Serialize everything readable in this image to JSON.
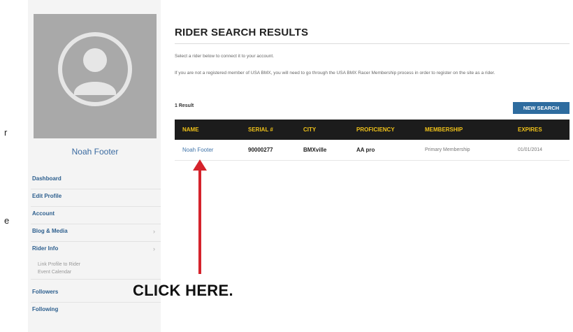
{
  "edge_fragments": [
    "r",
    "e"
  ],
  "sidebar": {
    "profile_name": "Noah Footer",
    "nav": [
      {
        "label": "Dashboard"
      },
      {
        "label": "Edit Profile"
      },
      {
        "label": "Account"
      },
      {
        "label": "Blog & Media",
        "caret": "›"
      },
      {
        "label": "Rider Info",
        "caret": "›",
        "sub_items": [
          "Link Profile to Rider",
          "Event Calendar"
        ]
      },
      {
        "label": "Followers"
      },
      {
        "label": "Following"
      }
    ]
  },
  "main": {
    "title": "RIDER SEARCH RESULTS",
    "intro": "Select a rider below to connect it to your account.",
    "notice": "If you are not a registered member of USA BMX, you will need to go through the USA BMX Racer Membership process in order to register on the site as a rider.",
    "result_count": "1 Result",
    "new_search_label": "NEW SEARCH",
    "table": {
      "headers": [
        "NAME",
        "SERIAL #",
        "CITY",
        "PROFICIENCY",
        "MEMBERSHIP",
        "EXPIRES"
      ],
      "rows": [
        [
          "Noah Footer",
          "90000277",
          "BMXville",
          "AA pro",
          "Primary Membership",
          "01/01/2014"
        ]
      ]
    }
  },
  "annotation": {
    "callout": "CLICK HERE.",
    "arrow_color": "#d5232c"
  },
  "colors": {
    "header_bg": "#1c1c1c",
    "header_text": "#f0c21a",
    "link": "#3f73a8",
    "button": "#2e6c9f"
  }
}
